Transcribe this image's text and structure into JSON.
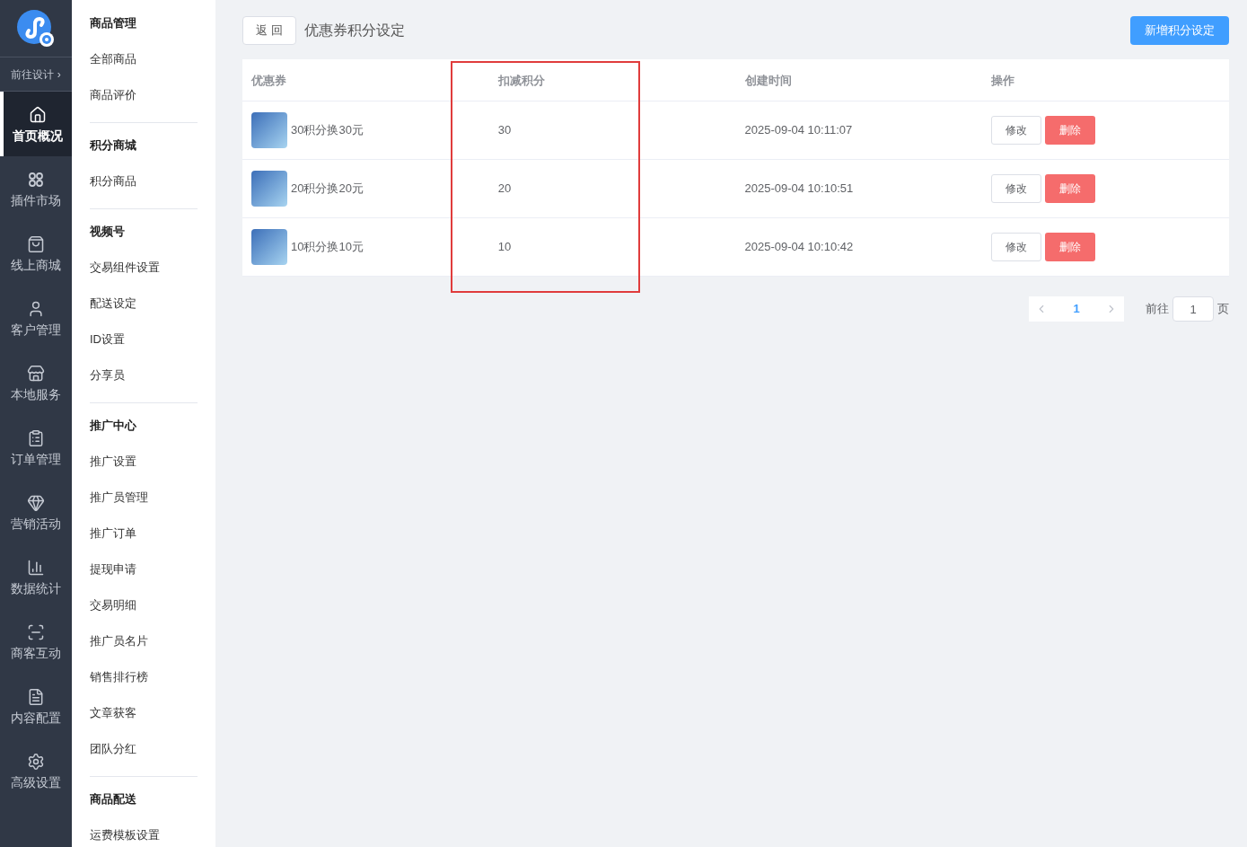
{
  "app_sidebar": {
    "design_link": "前往设计 ›",
    "items": [
      {
        "label": "首页概况",
        "selected": true
      },
      {
        "label": "插件市场",
        "selected": false
      },
      {
        "label": "线上商城",
        "selected": false
      },
      {
        "label": "客户管理",
        "selected": false
      },
      {
        "label": "本地服务",
        "selected": false
      },
      {
        "label": "订单管理",
        "selected": false
      },
      {
        "label": "营销活动",
        "selected": false
      },
      {
        "label": "数据统计",
        "selected": false
      },
      {
        "label": "商客互动",
        "selected": false
      },
      {
        "label": "内容配置",
        "selected": false
      },
      {
        "label": "高级设置",
        "selected": false
      }
    ]
  },
  "sub_menu": [
    {
      "title": "商品管理",
      "items": [
        "全部商品",
        "商品评价"
      ]
    },
    {
      "title": "积分商城",
      "items": [
        "积分商品"
      ]
    },
    {
      "title": "视频号",
      "items": [
        "交易组件设置",
        "配送设定",
        "ID设置",
        "分享员"
      ]
    },
    {
      "title": "推广中心",
      "items": [
        "推广设置",
        "推广员管理",
        "推广订单",
        "提现申请",
        "交易明细",
        "推广员名片",
        "销售排行榜",
        "文章获客",
        "团队分红"
      ]
    },
    {
      "title": "商品配送",
      "items": [
        "运费模板设置"
      ]
    }
  ],
  "header": {
    "back_button": "返 回",
    "title": "优惠券积分设定",
    "add_button": "新增积分设定"
  },
  "table": {
    "columns": [
      "优惠券",
      "扣减积分",
      "创建时间",
      "操作"
    ],
    "rows": [
      {
        "coupon": "30积分换30元",
        "points": "30",
        "created": "2025-09-04 10:11:07",
        "actions": [
          "修改",
          "删除"
        ]
      },
      {
        "coupon": "20积分换20元",
        "points": "20",
        "created": "2025-09-04 10:10:51",
        "actions": [
          "修改",
          "删除"
        ]
      },
      {
        "coupon": "10积分换10元",
        "points": "10",
        "created": "2025-09-04 10:10:42",
        "actions": [
          "修改",
          "删除"
        ]
      }
    ]
  },
  "pagination": {
    "pages": [
      {
        "label": "1",
        "selected": true
      }
    ],
    "goto_label": "前往",
    "goto_value": "1",
    "page_suffix": "页"
  }
}
